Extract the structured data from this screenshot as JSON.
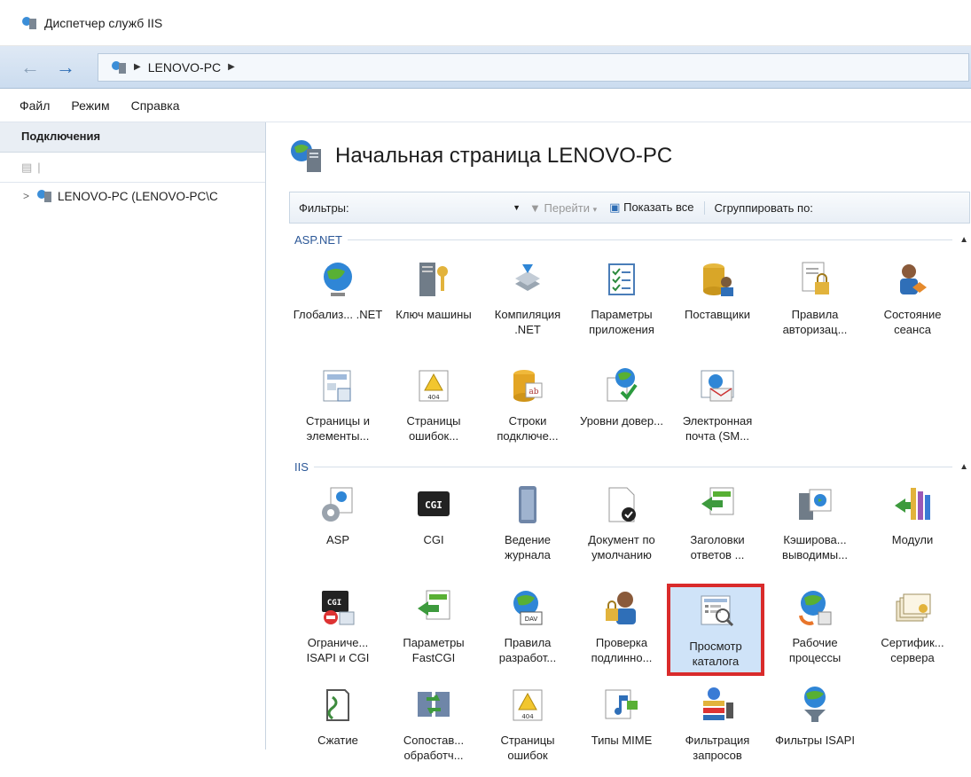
{
  "window": {
    "title": "Диспетчер служб IIS"
  },
  "address": {
    "segments": [
      "LENOVO-PC"
    ]
  },
  "menu": [
    "Файл",
    "Режим",
    "Справка"
  ],
  "connections": {
    "header": "Подключения",
    "tree_item": "LENOVO-PC (LENOVO-PC\\C"
  },
  "page": {
    "title": "Начальная страница LENOVO-PC"
  },
  "filter": {
    "label": "Фильтры:",
    "goto": "Перейти",
    "show_all": "Показать все",
    "group_by": "Сгруппировать по:"
  },
  "sections": [
    {
      "title": "ASP.NET",
      "items": [
        {
          "label": "Глобализ... .NET",
          "icon": "globe-icon"
        },
        {
          "label": "Ключ машины",
          "icon": "server-key-icon"
        },
        {
          "label": "Компиляция .NET",
          "icon": "compile-stack-icon"
        },
        {
          "label": "Параметры приложения",
          "icon": "checklist-icon"
        },
        {
          "label": "Поставщики",
          "icon": "database-users-icon"
        },
        {
          "label": "Правила авторизац...",
          "icon": "document-lock-icon"
        },
        {
          "label": "Состояние сеанса",
          "icon": "user-session-icon"
        },
        {
          "label": "Страницы и элементы...",
          "icon": "page-controls-icon"
        },
        {
          "label": "Страницы ошибок...",
          "icon": "error-404-icon"
        },
        {
          "label": "Строки подключе...",
          "icon": "connection-string-icon"
        },
        {
          "label": "Уровни довер...",
          "icon": "trust-globe-icon"
        },
        {
          "label": "Электронная почта (SM...",
          "icon": "email-icon"
        }
      ]
    },
    {
      "title": "IIS",
      "items": [
        {
          "label": "ASP",
          "icon": "asp-gear-icon"
        },
        {
          "label": "CGI",
          "icon": "cgi-icon"
        },
        {
          "label": "Ведение журнала",
          "icon": "log-icon"
        },
        {
          "label": "Документ по умолчанию",
          "icon": "default-document-icon"
        },
        {
          "label": "Заголовки ответов ...",
          "icon": "response-headers-icon"
        },
        {
          "label": "Кэширова... выводимы...",
          "icon": "output-cache-icon"
        },
        {
          "label": "Модули",
          "icon": "modules-icon"
        },
        {
          "label": "Ограниче... ISAPI и CGI",
          "icon": "isapi-cgi-restrict-icon"
        },
        {
          "label": "Параметры FastCGI",
          "icon": "fastcgi-icon"
        },
        {
          "label": "Правила разработ...",
          "icon": "webdav-icon"
        },
        {
          "label": "Проверка подлинно...",
          "icon": "authentication-icon"
        },
        {
          "label": "Просмотр каталога",
          "icon": "directory-browsing-icon",
          "selected": true
        },
        {
          "label": "Рабочие процессы",
          "icon": "worker-process-icon"
        },
        {
          "label": "Сертифик... сервера",
          "icon": "certificates-icon"
        },
        {
          "label": "Сжатие",
          "icon": "compression-icon"
        },
        {
          "label": "Сопостав... обработч...",
          "icon": "handler-mappings-icon"
        },
        {
          "label": "Страницы ошибок",
          "icon": "error-pages-icon"
        },
        {
          "label": "Типы MIME",
          "icon": "mime-icon"
        },
        {
          "label": "Фильтрация запросов",
          "icon": "request-filtering-icon"
        },
        {
          "label": "Фильтры ISAPI",
          "icon": "isapi-filters-icon"
        }
      ]
    }
  ]
}
